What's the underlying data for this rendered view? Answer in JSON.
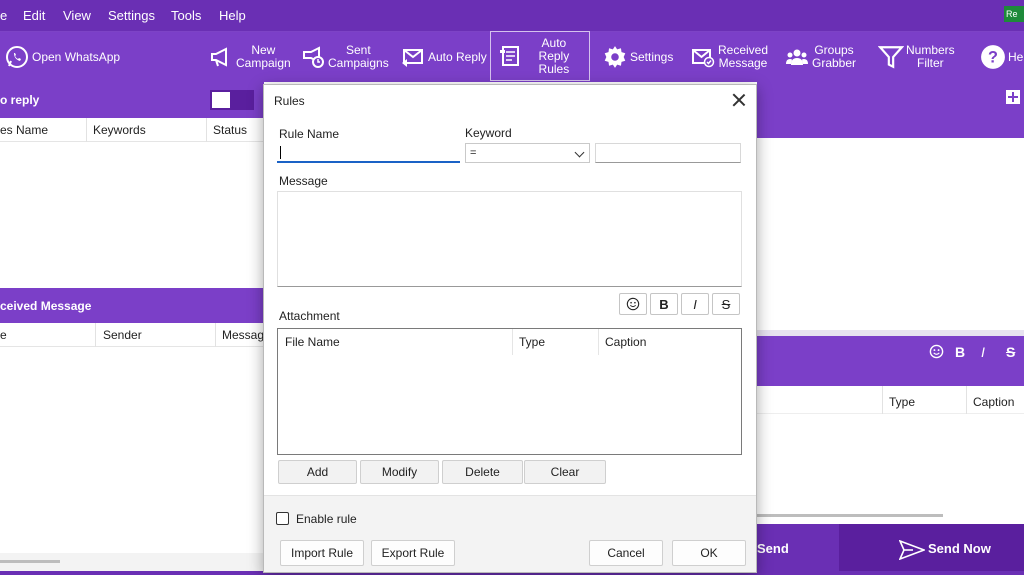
{
  "menu": {
    "items": [
      "e",
      "Edit",
      "View",
      "Settings",
      "Tools",
      "Help"
    ],
    "badge": "Re"
  },
  "toolbar": {
    "open_whatsapp": "Open WhatsApp",
    "new_campaign": [
      "New",
      "Campaign"
    ],
    "sent_campaigns": [
      "Sent",
      "Campaigns"
    ],
    "auto_reply": "Auto Reply",
    "auto_reply_rules": [
      "Auto Reply",
      "Rules"
    ],
    "settings": "Settings",
    "received_message": [
      "Received",
      "Message"
    ],
    "groups_grabber": [
      "Groups",
      "Grabber"
    ],
    "numbers_filter": [
      "Numbers",
      "Filter"
    ],
    "help": "Hel"
  },
  "auto_reply_panel": {
    "title": "o reply",
    "columns": [
      "es Name",
      "Keywords",
      "Status"
    ]
  },
  "received_panel": {
    "title": "ceived Message",
    "columns": [
      "e",
      "Sender",
      "Message"
    ]
  },
  "right_panel": {
    "format_buttons": [
      "B",
      "I",
      "S"
    ],
    "columns": [
      "Type",
      "Caption"
    ],
    "send": "Send",
    "send_now": "Send Now"
  },
  "dialog": {
    "title": "Rules",
    "rule_name_label": "Rule Name",
    "rule_name_value": "",
    "keyword_label": "Keyword",
    "keyword_operator": "=",
    "keyword_value": "",
    "message_label": "Message",
    "message_value": "",
    "format_buttons": [
      "☺",
      "B",
      "I",
      "S"
    ],
    "attachment_label": "Attachment",
    "attachment_columns": [
      "File Name",
      "Type",
      "Caption"
    ],
    "attachment_buttons": [
      "Add",
      "Modify",
      "Delete",
      "Clear"
    ],
    "enable_rule": "Enable rule",
    "enable_rule_checked": false,
    "import_rule": "Import Rule",
    "export_rule": "Export Rule",
    "cancel": "Cancel",
    "ok": "OK"
  }
}
